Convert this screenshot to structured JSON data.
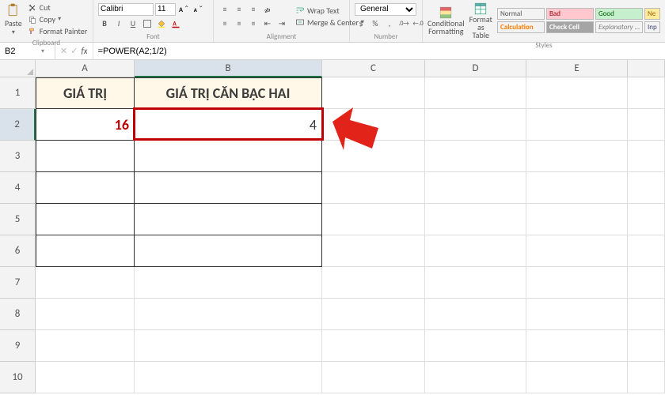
{
  "ribbon": {
    "clipboard": {
      "paste": "Paste",
      "cut": "Cut",
      "copy": "Copy",
      "format_painter": "Format Painter",
      "label": "Clipboard"
    },
    "font": {
      "name": "Calibri",
      "size": "11",
      "label": "Font"
    },
    "alignment": {
      "wrap": "Wrap Text",
      "merge": "Merge & Center",
      "label": "Alignment"
    },
    "number": {
      "format": "General",
      "label": "Number"
    },
    "styles": {
      "cond": "Conditional\nFormatting",
      "table": "Format as\nTable",
      "swatches": {
        "normal": "Normal",
        "bad": "Bad",
        "good": "Good",
        "ne": "Ne",
        "calculation": "Calculation",
        "check_cell": "Check Cell",
        "explanatory": "Explanatory ...",
        "inp": "Inp"
      },
      "label": "Styles"
    }
  },
  "formula_bar": {
    "name_box": "B2",
    "fx": "fx",
    "formula": "=POWER(A2;1/2)"
  },
  "columns": [
    "A",
    "B",
    "C",
    "D",
    "E"
  ],
  "row_numbers": [
    "1",
    "2",
    "3",
    "4",
    "5",
    "6",
    "7",
    "8",
    "9",
    "10"
  ],
  "headers": {
    "A": "GIÁ TRỊ",
    "B": "GIÁ TRỊ CĂN BẬC HAI"
  },
  "cells": {
    "A2": "16",
    "B2": "4"
  },
  "active_cell": "B2"
}
